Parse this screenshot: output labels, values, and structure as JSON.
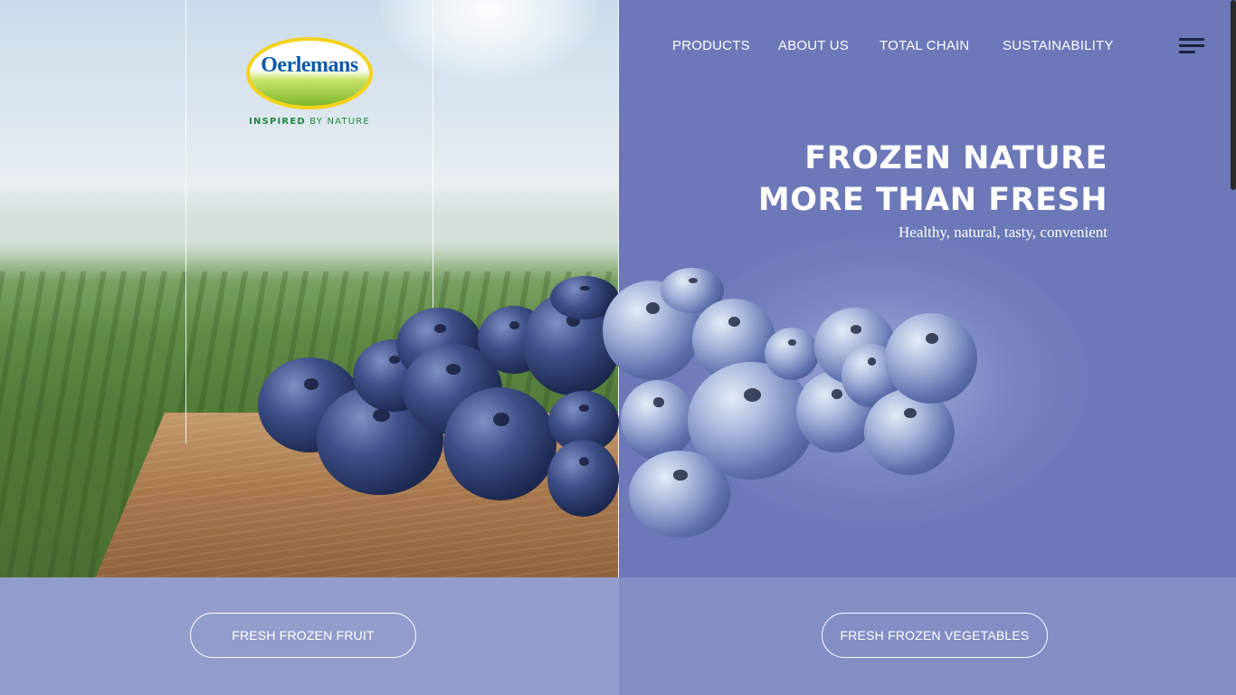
{
  "brand": {
    "name": "Oerlemans",
    "tagline_bold": "INSPIRED",
    "tagline_rest": "BY NATURE"
  },
  "nav": {
    "items": [
      {
        "label": "PRODUCTS"
      },
      {
        "label": "ABOUT US"
      },
      {
        "label": "TOTAL CHAIN"
      },
      {
        "label": "SUSTAINABILITY"
      }
    ],
    "menu_icon": "hamburger-menu-icon"
  },
  "hero": {
    "line1": "FROZEN NATURE",
    "line2": "MORE THAN FRESH",
    "subtitle": "Healthy, natural, tasty, convenient"
  },
  "buttons": {
    "fruit": "FRESH FROZEN FRUIT",
    "vegetables": "FRESH FROZEN VEGETABLES"
  },
  "colors": {
    "hero_right_bg": "#6c78b8",
    "bottom_left_bg": "#939dcb",
    "bottom_right_bg": "#838ec4",
    "logo_blue": "#0f5aa8",
    "logo_green": "#1c8a3a",
    "logo_yellow": "#f4d21a"
  }
}
